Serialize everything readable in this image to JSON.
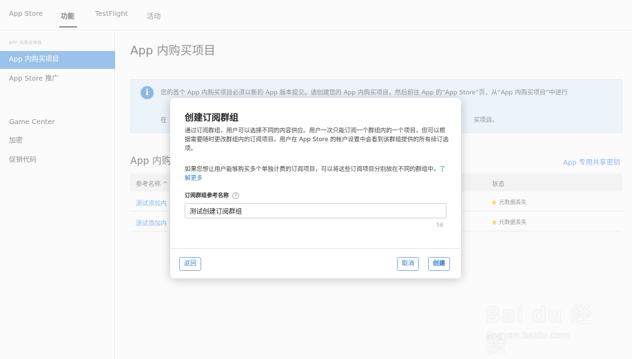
{
  "topnav": {
    "tabs": [
      {
        "label": "App Store"
      },
      {
        "label": "功能"
      },
      {
        "label": "TestFlight"
      },
      {
        "label": "活动"
      }
    ]
  },
  "sidebar": {
    "section_label": "APP 内购买项目",
    "items": [
      {
        "label": "App 内购买项目"
      },
      {
        "label": "App Store 推广"
      },
      {
        "label": "Game Center"
      },
      {
        "label": "加密"
      },
      {
        "label": "促销代码"
      }
    ]
  },
  "main": {
    "title": "App 内购买项目",
    "info": {
      "line1": "您的首个 App 内购买项目必须以新的 App 版本提交。请创建您的 App 内购买项目，然后前往 App 的“App Store”页，从“App 内购买项目”中进行",
      "line2": "在",
      "line_tail": "买项目。"
    },
    "section_title": "App 内购",
    "shared_secret": "App 专用共享密钥",
    "table": {
      "col_ref": "参考名称 ^",
      "col_status": "状态",
      "rows": [
        {
          "name": "测试添加内",
          "status": "元数据丢失"
        },
        {
          "name": "测试添加内",
          "status": "元数据丢失"
        }
      ]
    }
  },
  "modal": {
    "title": "创建订阅群组",
    "desc": "通过订阅群组，用户可以选择不同的内容供应。用户一次只能订阅一个群组内的一个项目，但可以根据需要随时更改群组内的订阅项目。用户在 App Store 的帐户设置中会看到该群组提供的所有续订选项。",
    "desc2": "如果您想让用户能够购买多个单独计费的订阅项目，可以将这些订阅项目分别放在不同的群组中。",
    "learn_more": "了解更多",
    "field_label": "订阅群组参考名称",
    "help_glyph": "?",
    "field_value": "测试创建订阅群组",
    "char_count": "56",
    "back_label": "返回",
    "cancel_label": "取消",
    "create_label": "创建"
  },
  "colors": {
    "accent": "#2f7fd1",
    "sidebar_active": "#4a90d9",
    "status_dot": "#f0c419"
  }
}
